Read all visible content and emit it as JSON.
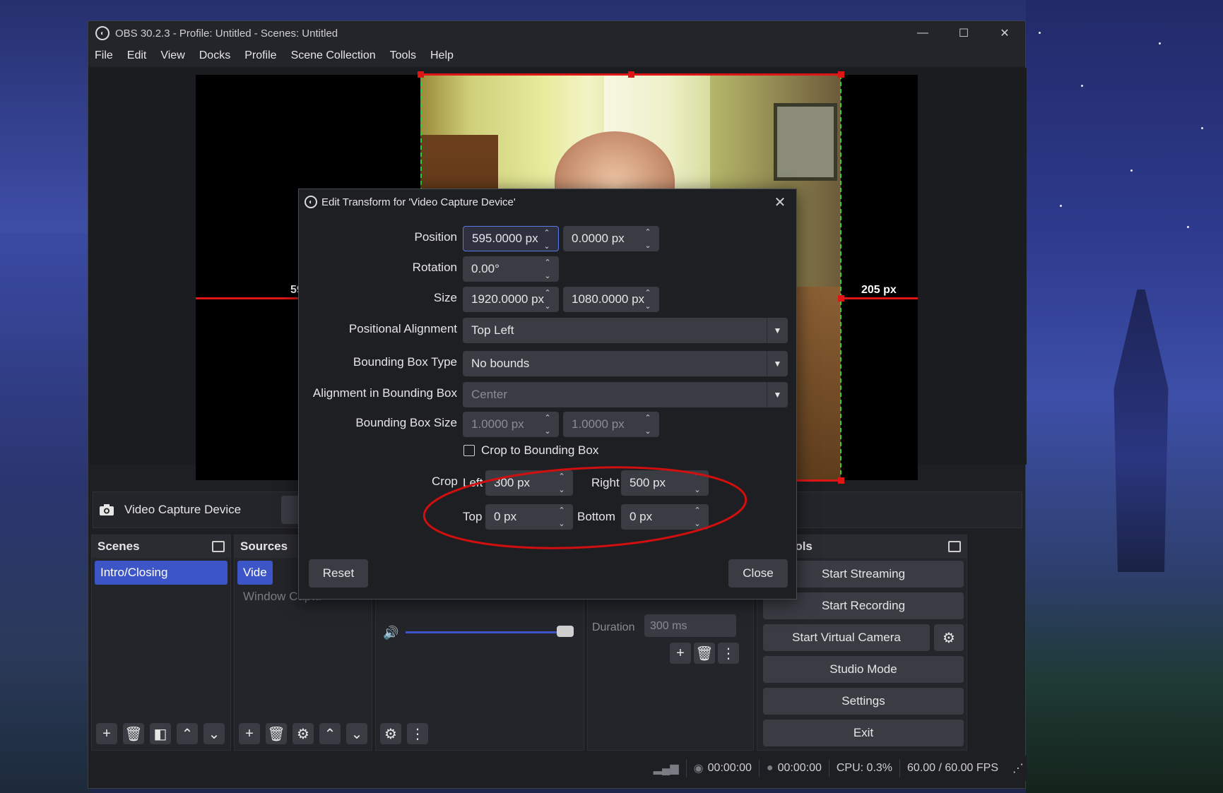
{
  "window": {
    "title": "OBS 30.2.3 - Profile: Untitled - Scenes: Untitled",
    "minimize": "—",
    "maximize": "☐",
    "close": "✕"
  },
  "menu": [
    "File",
    "Edit",
    "View",
    "Docks",
    "Profile",
    "Scene Collection",
    "Tools",
    "Help"
  ],
  "preview": {
    "crop_left_label": "59",
    "crop_right_label": "205 px"
  },
  "source_bar": {
    "name": "Video Capture Device"
  },
  "scenes": {
    "title": "Scenes",
    "items": [
      "Intro/Closing"
    ]
  },
  "sources": {
    "title": "Sources",
    "items": [
      "Vide",
      "Window Captu"
    ]
  },
  "transition": {
    "duration_label": "Duration",
    "duration_value": "300 ms"
  },
  "controls": {
    "title": "Controls",
    "start_streaming": "Start Streaming",
    "start_recording": "Start Recording",
    "start_virtual_camera": "Start Virtual Camera",
    "studio_mode": "Studio Mode",
    "settings": "Settings",
    "exit": "Exit"
  },
  "status": {
    "stream_time": "00:00:00",
    "record_time": "00:00:00",
    "cpu": "CPU: 0.3%",
    "fps": "60.00 / 60.00 FPS"
  },
  "dialog": {
    "title": "Edit Transform for 'Video Capture Device'",
    "position_label": "Position",
    "position_x": "595.0000 px",
    "position_y": "0.0000 px",
    "rotation_label": "Rotation",
    "rotation": "0.00°",
    "size_label": "Size",
    "size_w": "1920.0000 px",
    "size_h": "1080.0000 px",
    "pos_align_label": "Positional Alignment",
    "pos_align": "Top Left",
    "bbox_type_label": "Bounding Box Type",
    "bbox_type": "No bounds",
    "bbox_align_label": "Alignment in Bounding Box",
    "bbox_align": "Center",
    "bbox_size_label": "Bounding Box Size",
    "bbox_w": "1.0000 px",
    "bbox_h": "1.0000 px",
    "crop_to_bbox": "Crop to Bounding Box",
    "crop_label": "Crop",
    "crop_left_label": "Left",
    "crop_left": "300 px",
    "crop_right_label": "Right",
    "crop_right": "500 px",
    "crop_top_label": "Top",
    "crop_top": "0 px",
    "crop_bottom_label": "Bottom",
    "crop_bottom": "0 px",
    "reset": "Reset",
    "close": "Close"
  }
}
